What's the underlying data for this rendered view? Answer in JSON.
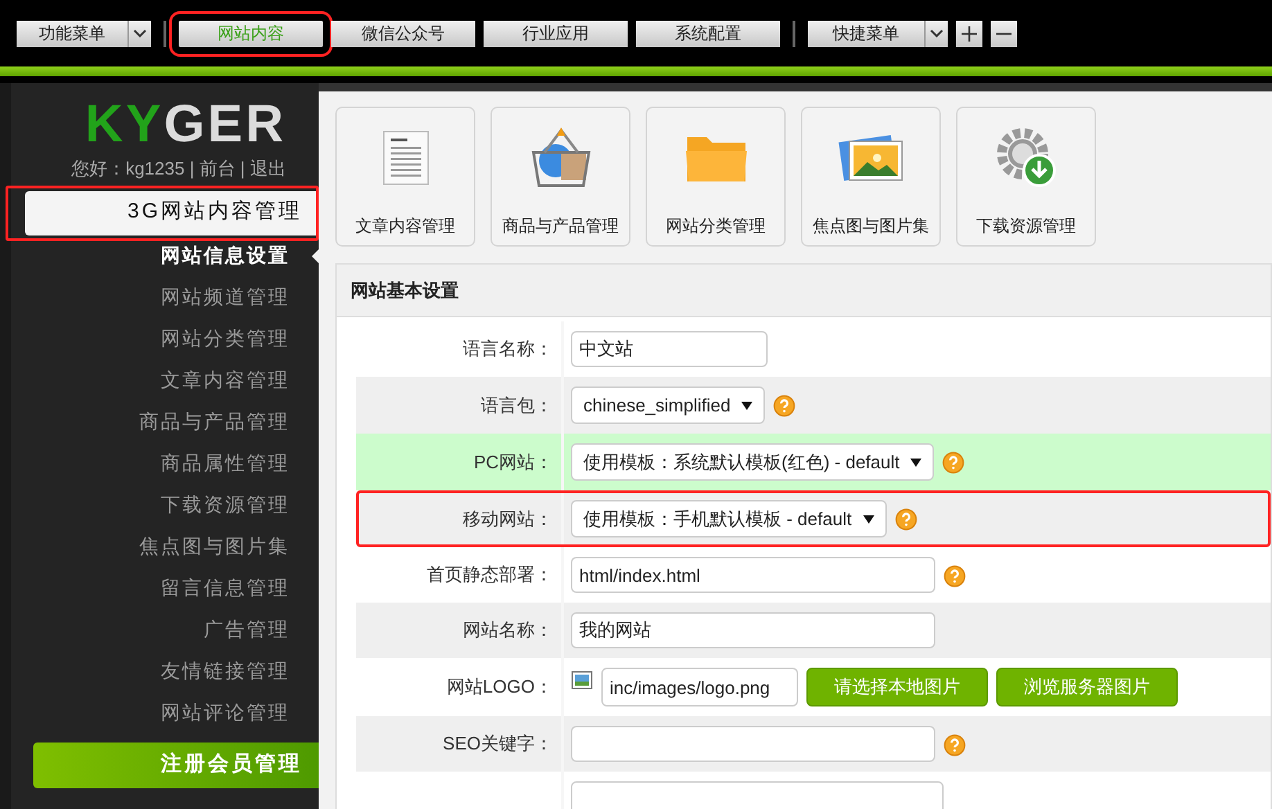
{
  "top_menu": {
    "function_menu": "功能菜单",
    "tabs": [
      {
        "label": "网站内容",
        "selected": true,
        "highlighted": true
      },
      {
        "label": "微信公众号",
        "selected": false,
        "highlighted": false
      },
      {
        "label": "行业应用",
        "selected": false,
        "highlighted": false
      },
      {
        "label": "系统配置",
        "selected": false,
        "highlighted": false
      }
    ],
    "quick_menu": "快捷菜单"
  },
  "sidebar": {
    "logo": "KYGER",
    "greeting": "您好：kg1235 | 前台 | 退出",
    "section": "3G网站内容管理",
    "highlighted": true,
    "items": [
      {
        "label": "网站信息设置",
        "selected": true
      },
      {
        "label": "网站频道管理",
        "selected": false
      },
      {
        "label": "网站分类管理",
        "selected": false
      },
      {
        "label": "文章内容管理",
        "selected": false
      },
      {
        "label": "商品与产品管理",
        "selected": false
      },
      {
        "label": "商品属性管理",
        "selected": false
      },
      {
        "label": "下载资源管理",
        "selected": false
      },
      {
        "label": "焦点图与图片集",
        "selected": false
      },
      {
        "label": "留言信息管理",
        "selected": false
      },
      {
        "label": "广告管理",
        "selected": false
      },
      {
        "label": "友情链接管理",
        "selected": false
      },
      {
        "label": "网站评论管理",
        "selected": false
      }
    ],
    "bottom_section": "注册会员管理"
  },
  "shortcuts": [
    {
      "kind": "document",
      "label": "文章内容管理"
    },
    {
      "kind": "basket",
      "label": "商品与产品管理"
    },
    {
      "kind": "folder",
      "label": "网站分类管理"
    },
    {
      "kind": "pictures",
      "label": "焦点图与图片集"
    },
    {
      "kind": "download",
      "label": "下载资源管理"
    }
  ],
  "panel": {
    "title": "网站基本设置",
    "rows": [
      {
        "kind": "short_text",
        "label": "语言名称：",
        "value": "中文站",
        "help": false,
        "highlighted": false,
        "hovered": false
      },
      {
        "kind": "select",
        "label": "语言包：",
        "value": "chinese_simplified",
        "help": true,
        "highlighted": false,
        "hovered": false
      },
      {
        "kind": "select",
        "label": "PC网站：",
        "value": "使用模板：系统默认模板(红色) - default",
        "help": true,
        "highlighted": false,
        "hovered": true
      },
      {
        "kind": "select",
        "label": "移动网站：",
        "value": "使用模板：手机默认模板 - default",
        "help": true,
        "highlighted": true,
        "hovered": false
      },
      {
        "kind": "text",
        "label": "首页静态部署：",
        "value": "html/index.html",
        "help": true,
        "highlighted": false,
        "hovered": false
      },
      {
        "kind": "text",
        "label": "网站名称：",
        "value": "我的网站",
        "help": false,
        "highlighted": false,
        "hovered": false
      },
      {
        "kind": "image",
        "label": "网站LOGO：",
        "value": "inc/images/logo.png",
        "buttons": [
          "请选择本地图片",
          "浏览服务器图片"
        ],
        "help": false,
        "highlighted": false,
        "hovered": false
      },
      {
        "kind": "text",
        "label": "SEO关键字：",
        "value": "",
        "help": true,
        "highlighted": false,
        "hovered": false
      },
      {
        "kind": "textarea",
        "value": "",
        "help": false,
        "highlighted": false,
        "hovered": false
      }
    ]
  }
}
